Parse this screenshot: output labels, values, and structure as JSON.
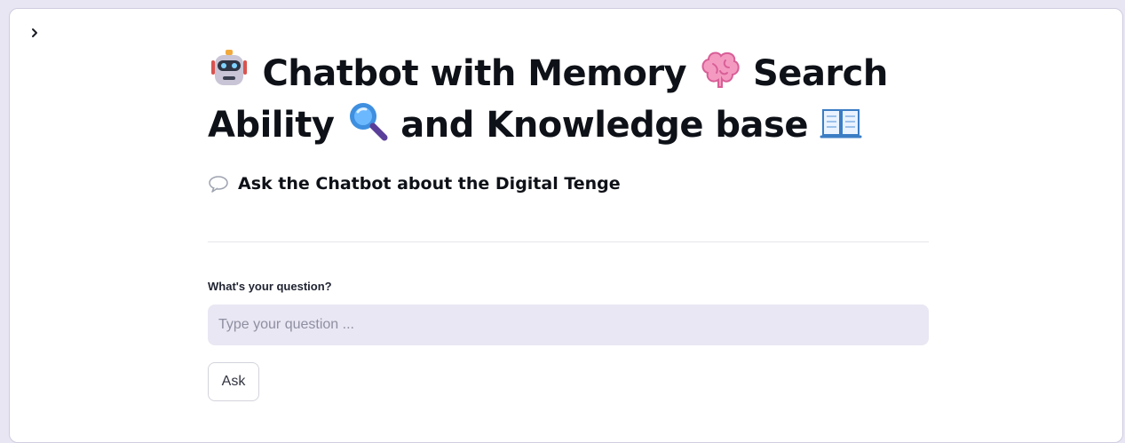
{
  "sidebar": {
    "toggle_icon": "chevron-right-icon"
  },
  "header": {
    "robot_icon": "robot-face-emoji-icon",
    "title_part1": "Chatbot with Memory",
    "brain_icon": "brain-emoji-icon",
    "title_part2": "Search",
    "title_part3": "Ability",
    "magnifier_icon": "magnifying-glass-emoji-icon",
    "title_part4": "and Knowledge base",
    "book_icon": "open-book-emoji-icon"
  },
  "subtitle": {
    "icon": "speech-bubble-icon",
    "text": "Ask the Chatbot about the Digital Tenge"
  },
  "form": {
    "label": "What's your question?",
    "placeholder": "Type your question ...",
    "value": "",
    "button_label": "Ask"
  },
  "colors": {
    "background": "#ffffff",
    "input_background": "#e9e7f3",
    "text": "#0e1117"
  }
}
